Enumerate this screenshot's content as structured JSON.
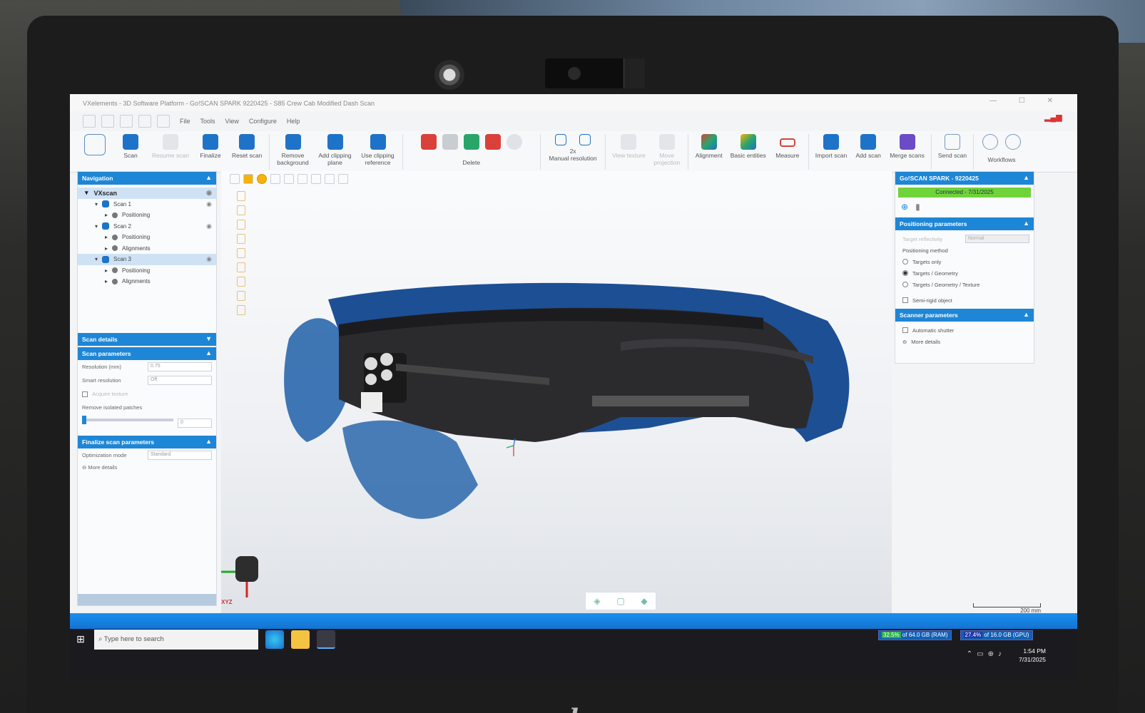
{
  "app": {
    "title": "VXelements - 3D Software Platform - Go!SCAN SPARK 9220425 - S85 Crew Cab Modified Dash Scan",
    "window_controls": "— ☐ ✕",
    "menu": [
      "File",
      "Tools",
      "View",
      "Configure",
      "Help"
    ]
  },
  "ribbon": {
    "scan": "Scan",
    "resume_scan": "Resume scan",
    "finalize": "Finalize",
    "reset_scan": "Reset scan",
    "remove_background": "Remove background",
    "add_clipping_plane": "Add clipping plane",
    "use_clipping_reference": "Use clipping reference",
    "delete": "Delete",
    "resolution_value": "2x",
    "manual_resolution": "Manual resolution",
    "view_texture": "View texture",
    "move_projection": "Move projection",
    "alignment": "Alignment",
    "basic_entities": "Basic entities",
    "measure": "Measure",
    "import_scan": "Import scan",
    "add_scan": "Add scan",
    "merge_scans": "Merge scans",
    "send_scan": "Send scan",
    "workflows": "Workflows"
  },
  "navigation": {
    "header": "Navigation",
    "root": "VXscan",
    "items": [
      {
        "label": "Scan 1",
        "level": 1,
        "selected": false
      },
      {
        "label": "Positioning",
        "level": 2,
        "selected": false
      },
      {
        "label": "Scan 2",
        "level": 1,
        "selected": false
      },
      {
        "label": "Positioning",
        "level": 2,
        "selected": false
      },
      {
        "label": "Alignments",
        "level": 2,
        "selected": false
      },
      {
        "label": "Scan 3",
        "level": 1,
        "selected": true
      },
      {
        "label": "Positioning",
        "level": 2,
        "selected": false
      },
      {
        "label": "Alignments",
        "level": 2,
        "selected": false
      }
    ]
  },
  "scan_details": {
    "header": "Scan details"
  },
  "scan_parameters": {
    "header": "Scan parameters",
    "resolution_label": "Resolution (mm)",
    "resolution_value": "0.75",
    "smart_resolution_label": "Smart resolution",
    "smart_resolution_value": "Off",
    "acquire_texture_label": "Acquire texture",
    "remove_patches_label": "Remove isolated patches",
    "remove_patches_value": "0"
  },
  "finalize_params": {
    "header": "Finalize scan parameters",
    "optimization_label": "Optimization mode",
    "optimization_value": "Standard",
    "more_details": "More details"
  },
  "device": {
    "header": "Go!SCAN SPARK - 9220425",
    "status": "Connected - 7/31/2025",
    "status_color": "#6fd33a"
  },
  "positioning_params": {
    "header": "Positioning parameters",
    "target_reflectivity_label": "Target reflectivity",
    "target_reflectivity_value": "Normal",
    "method_label": "Positioning method",
    "options": [
      "Targets only",
      "Targets / Geometry",
      "Targets / Geometry / Texture"
    ],
    "selected_index": 1,
    "semi_rigid": "Semi-rigid object"
  },
  "scanner_params": {
    "header": "Scanner parameters",
    "automatic_shutter": "Automatic shutter",
    "more_details": "More details"
  },
  "viewport": {
    "scale_label": "200 mm",
    "axis_label": "XYZ"
  },
  "taskbar": {
    "search_placeholder": "Type here to search",
    "ram_pct": "32.5%",
    "ram_text": "of 64.0 GB (RAM)",
    "gpu_pct": "27.4%",
    "gpu_text": "of 16.0 GB (GPU)",
    "time": "1:54 PM",
    "date": "7/31/2025"
  },
  "colors": {
    "accent": "#1e86d6",
    "scan_blue": "#1e5fa8",
    "connected": "#6fd33a"
  }
}
